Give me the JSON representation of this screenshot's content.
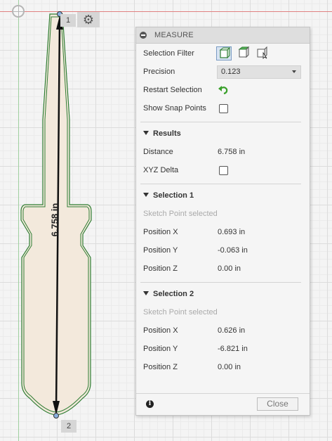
{
  "canvas": {
    "point_1": "1",
    "point_2": "2",
    "dimension": "6.758 in"
  },
  "panel": {
    "title": "MEASURE",
    "selection_filter_label": "Selection Filter",
    "precision_label": "Precision",
    "precision_value": "0.123",
    "restart_selection_label": "Restart Selection",
    "show_snap_points_label": "Show Snap Points",
    "results": {
      "heading": "Results",
      "distance_label": "Distance",
      "distance_value": "6.758 in",
      "xyz_delta_label": "XYZ Delta"
    },
    "selection1": {
      "heading": "Selection 1",
      "status": "Sketch Point selected",
      "pos_x_label": "Position X",
      "pos_x_value": "0.693 in",
      "pos_y_label": "Position Y",
      "pos_y_value": "-0.063 in",
      "pos_z_label": "Position Z",
      "pos_z_value": "0.00 in"
    },
    "selection2": {
      "heading": "Selection 2",
      "status": "Sketch Point selected",
      "pos_x_label": "Position X",
      "pos_x_value": "0.626 in",
      "pos_y_label": "Position Y",
      "pos_y_value": "-6.821 in",
      "pos_z_label": "Position Z",
      "pos_z_value": "0.00 in"
    },
    "close_label": "Close"
  },
  "icons": {
    "gear": "gear-icon",
    "restart": "restart-arrow-icon",
    "info": "info-icon",
    "filter": [
      "filter-body-icon",
      "filter-face-icon",
      "filter-vertex-icon"
    ]
  },
  "colors": {
    "sketch_outline": "#2e7d32",
    "sketch_fill": "#f3e9dc",
    "axis_x": "#e08080",
    "axis_y": "#9fcf9f",
    "restart_green": "#3aa02b"
  }
}
